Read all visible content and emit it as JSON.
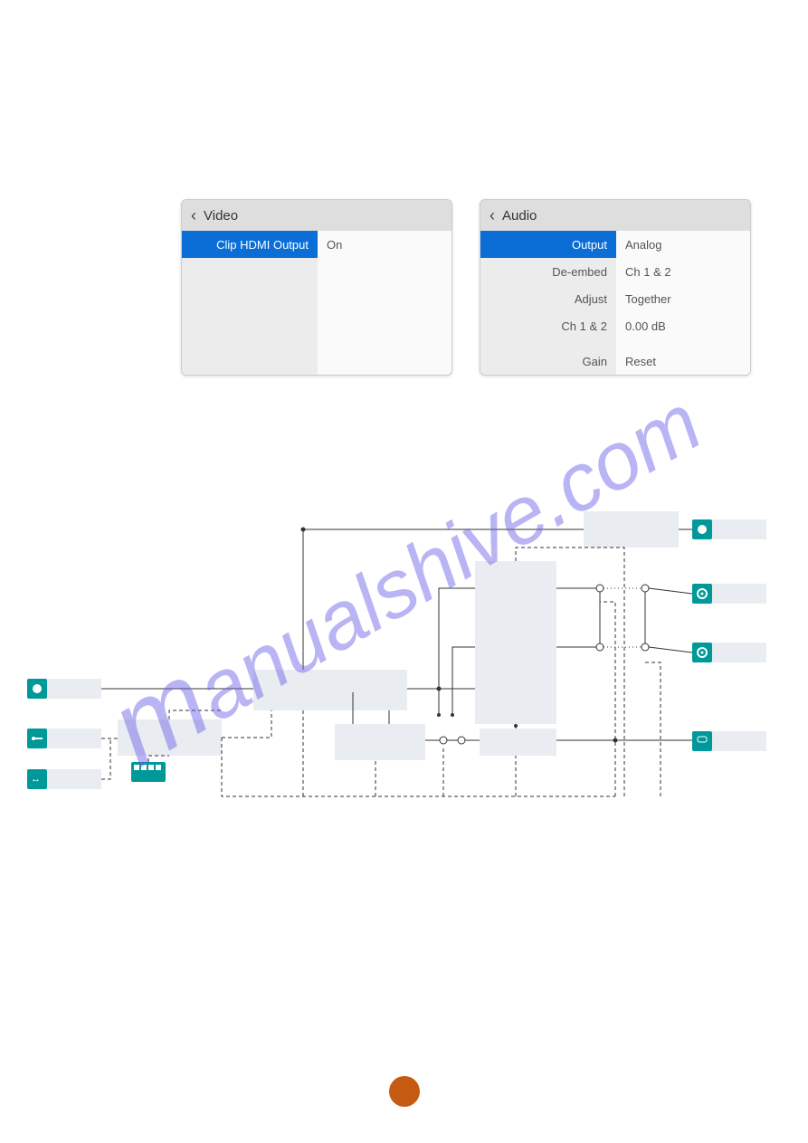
{
  "watermark": "manualshive.com",
  "panels": {
    "video": {
      "title": "Video",
      "rows": [
        {
          "label": "Clip HDMI Output",
          "value": "On",
          "selected": true
        }
      ]
    },
    "audio": {
      "title": "Audio",
      "rows": [
        {
          "label": "Output",
          "value": "Analog",
          "selected": true
        },
        {
          "label": "De-embed",
          "value": "Ch 1 & 2",
          "selected": false
        },
        {
          "label": "Adjust",
          "value": "Together",
          "selected": false
        },
        {
          "label": "Ch 1 & 2",
          "value": "0.00 dB",
          "selected": false
        },
        {
          "label": "Gain",
          "value": "Reset",
          "selected": false,
          "gapBefore": true
        }
      ]
    }
  }
}
